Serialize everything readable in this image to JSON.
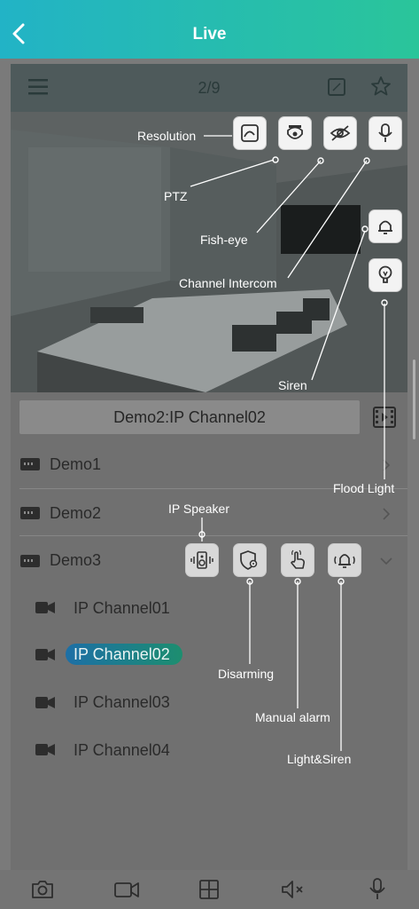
{
  "header": {
    "title": "Live"
  },
  "toolbar": {
    "page_indicator": "2/9"
  },
  "channel_bar": {
    "label": "Demo2:IP Channel02"
  },
  "devices": [
    {
      "label": "Demo1"
    },
    {
      "label": "Demo2"
    },
    {
      "label": "Demo3"
    }
  ],
  "channels": [
    {
      "label": "IP Channel01"
    },
    {
      "label": "IP Channel02"
    },
    {
      "label": "IP Channel03"
    },
    {
      "label": "IP Channel04"
    }
  ],
  "annotations": {
    "resolution": "Resolution",
    "ptz": "PTZ",
    "fisheye": "Fish-eye",
    "intercom": "Channel Intercom",
    "siren": "Siren",
    "flood_light": "Flood Light",
    "ip_speaker": "IP Speaker",
    "disarming": "Disarming",
    "manual_alarm": "Manual alarm",
    "light_siren": "Light&Siren"
  },
  "colors": {
    "header_start": "#22b3c6",
    "header_end": "#2ac59a",
    "selected_channel": "#1d7fa0"
  }
}
